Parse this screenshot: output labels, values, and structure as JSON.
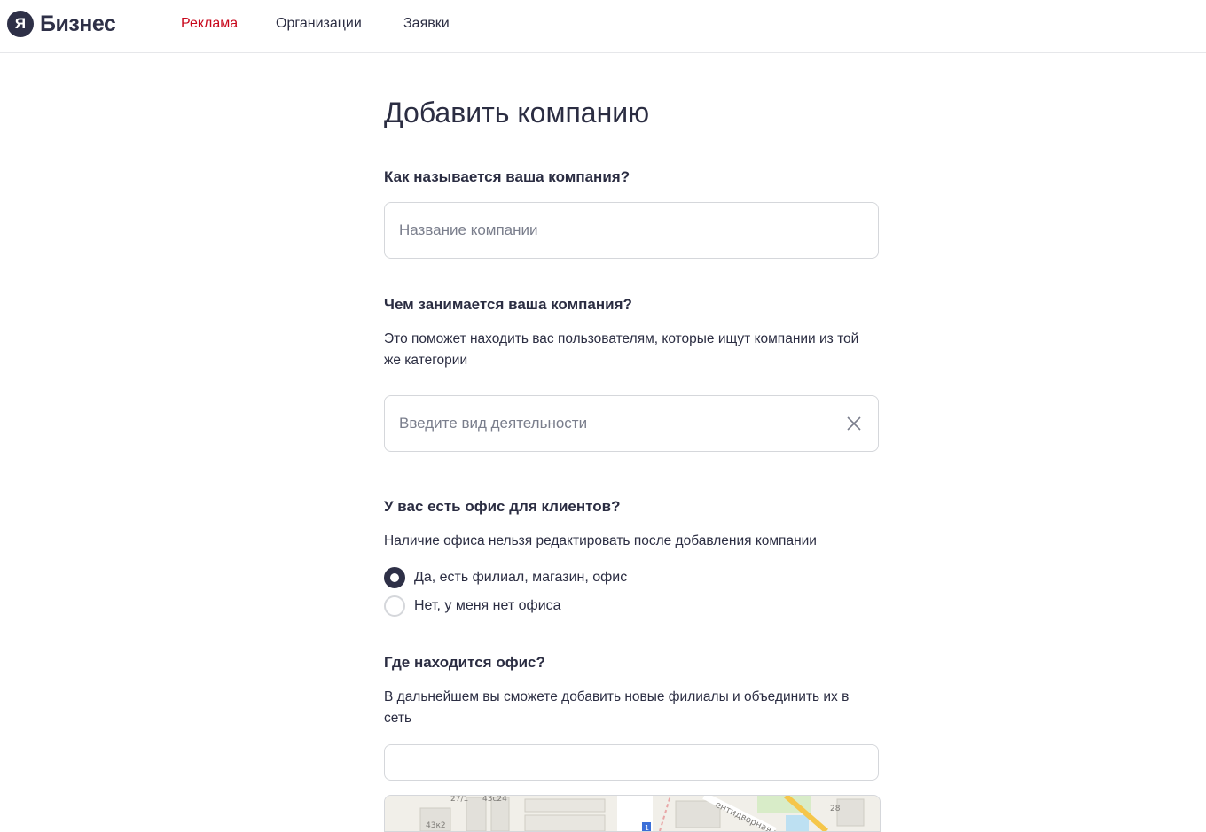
{
  "header": {
    "logo_letter": "Я",
    "logo_word": "Бизнес",
    "nav": [
      {
        "label": "Реклама",
        "active": true
      },
      {
        "label": "Организации",
        "active": false
      },
      {
        "label": "Заявки",
        "active": false
      }
    ]
  },
  "page": {
    "title": "Добавить компанию"
  },
  "form": {
    "name": {
      "question": "Как называется ваша компания?",
      "placeholder": "Название компании",
      "value": ""
    },
    "activity": {
      "question": "Чем занимается ваша компания?",
      "hint": "Это поможет находить вас пользователям, которые ищут компании из той же категории",
      "placeholder": "Введите вид деятельности",
      "value": "",
      "clear_icon": "close-icon"
    },
    "office": {
      "question": "У вас есть офис для клиентов?",
      "hint": "Наличие офиса нельзя редактировать после добавления компании",
      "options": [
        {
          "label": "Да, есть филиал, магазин, офис",
          "checked": true
        },
        {
          "label": "Нет, у меня нет офиса",
          "checked": false
        }
      ]
    },
    "location": {
      "question": "Где находится офис?",
      "hint": "В дальнейшем вы сможете добавить новые филиалы и объединить их в сеть",
      "value": "",
      "map_labels": [
        "27/1",
        "43с24",
        "43к2",
        "1",
        "ентидворная у",
        "28"
      ]
    }
  },
  "colors": {
    "accent_red": "#c8071b",
    "brand_dark": "#2e3047",
    "text": "#2b2d42",
    "border": "#d5d7db",
    "placeholder": "#7a7e8c"
  }
}
